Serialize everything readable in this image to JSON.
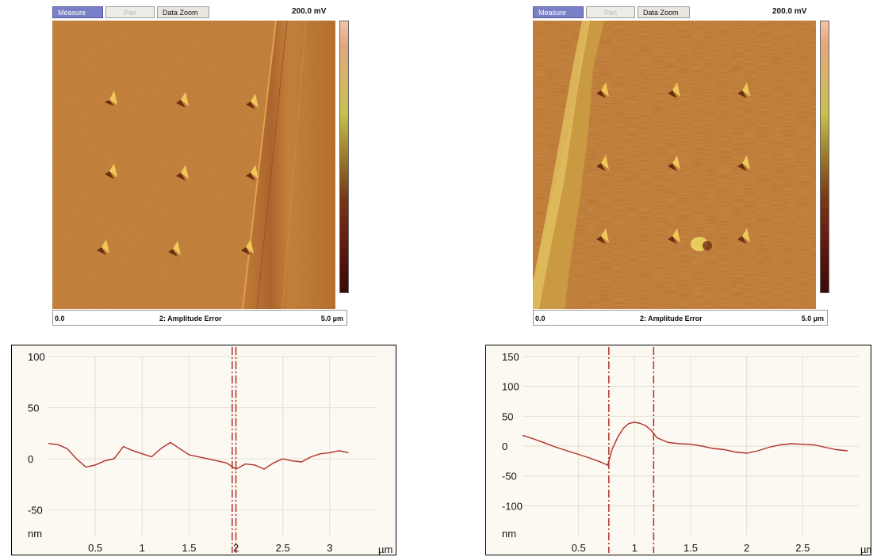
{
  "toolbar": {
    "measure": "Measure",
    "pan": "Pan",
    "data_zoom": "Data Zoom"
  },
  "scale_max": "200.0 mV",
  "image_left": {
    "x_start": "0.0",
    "channel": "2: Amplitude Error",
    "x_end": "5.0 µm"
  },
  "image_right": {
    "x_start": "0.0",
    "channel": "2: Amplitude Error",
    "x_end": "5.0 µm"
  },
  "colors": {
    "profile_line": "#b0302a",
    "cursor": "#b0302a",
    "grid": "#e4dfcf",
    "active_button": "#7a80c8"
  },
  "chart_data": [
    {
      "type": "line",
      "ylim": [
        -75,
        100
      ],
      "xlim": [
        0,
        3.5
      ],
      "y_ticks": [
        100,
        50,
        0,
        -50
      ],
      "y_unit": "nm",
      "x_ticks": [
        0.5,
        1,
        1.5,
        2,
        2.5,
        3
      ],
      "x_unit": "µm",
      "tick_labels_y": [
        "100",
        "50",
        "0",
        "-50"
      ],
      "tick_labels_x": [
        "0.5",
        "1",
        "1.5",
        "2",
        "2.5",
        "3"
      ],
      "cursors": [
        1.96,
        2.0
      ],
      "x": [
        0,
        0.1,
        0.2,
        0.3,
        0.4,
        0.5,
        0.6,
        0.7,
        0.8,
        0.9,
        1.0,
        1.1,
        1.2,
        1.3,
        1.4,
        1.5,
        1.6,
        1.7,
        1.8,
        1.9,
        2.0,
        2.1,
        2.2,
        2.3,
        2.4,
        2.5,
        2.6,
        2.7,
        2.8,
        2.9,
        3.0,
        3.1,
        3.2
      ],
      "y": [
        15,
        14,
        10,
        0,
        -8,
        -6,
        -2,
        0,
        12,
        8,
        5,
        2,
        10,
        16,
        10,
        4,
        2,
        0,
        -2,
        -4,
        -10,
        -5,
        -6,
        -10,
        -4,
        0,
        -2,
        -3,
        2,
        5,
        6,
        8,
        6
      ]
    },
    {
      "type": "line",
      "ylim": [
        -150,
        150
      ],
      "xlim": [
        0,
        3.0
      ],
      "y_ticks": [
        150,
        100,
        50,
        0,
        -50,
        -100
      ],
      "y_unit": "nm",
      "x_ticks": [
        0.5,
        1,
        1.5,
        2,
        2.5
      ],
      "x_unit": "µm",
      "tick_labels_y": [
        "150",
        "100",
        "50",
        "0",
        "-50",
        "-100"
      ],
      "tick_labels_x": [
        "0.5",
        "1",
        "1.5",
        "2",
        "2.5"
      ],
      "cursors": [
        0.77,
        1.17
      ],
      "x": [
        0,
        0.1,
        0.2,
        0.3,
        0.4,
        0.5,
        0.6,
        0.7,
        0.76,
        0.8,
        0.85,
        0.9,
        0.95,
        1.0,
        1.05,
        1.1,
        1.15,
        1.2,
        1.3,
        1.4,
        1.5,
        1.6,
        1.7,
        1.8,
        1.9,
        2.0,
        2.1,
        2.2,
        2.3,
        2.4,
        2.5,
        2.6,
        2.7,
        2.8,
        2.9
      ],
      "y": [
        18,
        12,
        5,
        -2,
        -8,
        -14,
        -20,
        -27,
        -32,
        -5,
        15,
        30,
        38,
        40,
        38,
        34,
        26,
        14,
        6,
        4,
        3,
        0,
        -4,
        -6,
        -10,
        -12,
        -8,
        -2,
        2,
        4,
        3,
        2,
        -2,
        -6,
        -8
      ]
    }
  ]
}
